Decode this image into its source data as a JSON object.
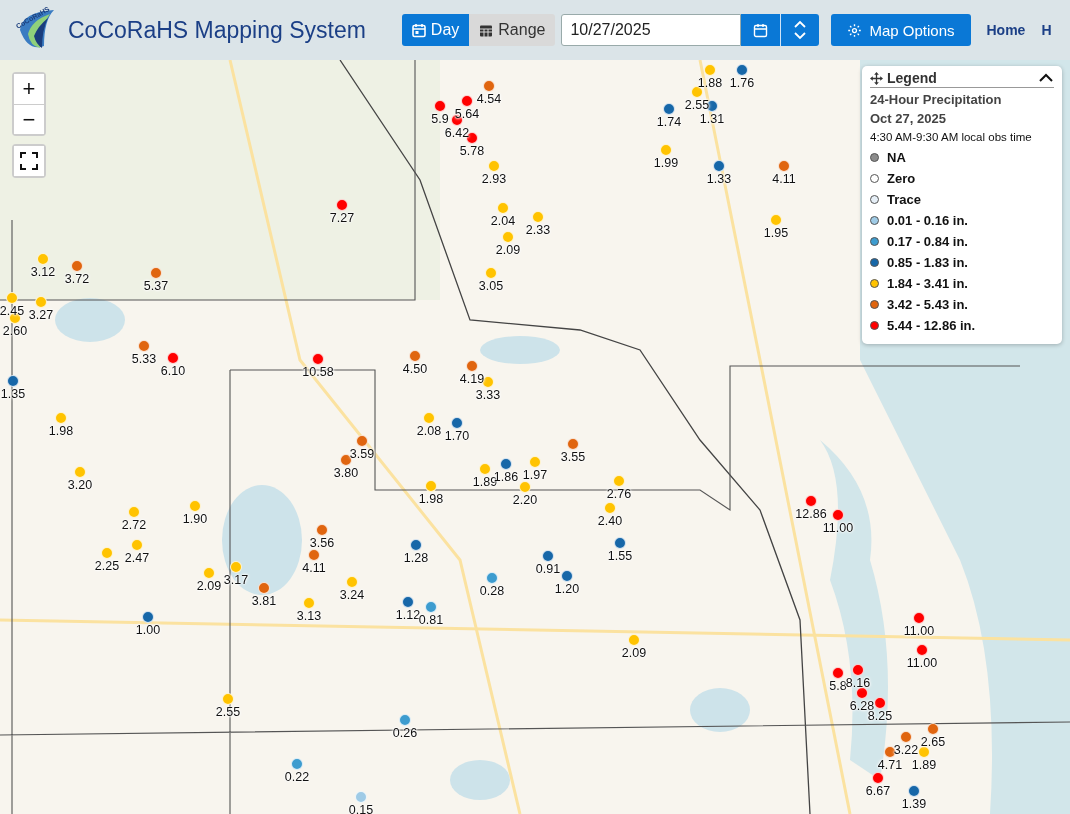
{
  "header": {
    "logo_text": "CoCoRaHS",
    "title": "CoCoRaHS Mapping System",
    "mode_tabs": [
      {
        "label": "Day",
        "selected": true
      },
      {
        "label": "Range",
        "selected": false
      }
    ],
    "date": {
      "value": "10/27/2025"
    },
    "map_options": "Map Options",
    "nav_links": [
      "Home",
      "H"
    ]
  },
  "map": {
    "controls": {
      "zoom_in": "+",
      "zoom_out": "−"
    },
    "stations": [
      {
        "value": "1.88",
        "color": "#ffc300"
      },
      {
        "value": "1.76",
        "color": "#1767a8"
      },
      {
        "value": "4.54",
        "color": "#e0650f"
      },
      {
        "value": "2.55",
        "color": "#ffc300"
      },
      {
        "value": "5.9",
        "color": "#ff0000"
      },
      {
        "value": "5.64",
        "color": "#ff0000"
      },
      {
        "value": "1.74",
        "color": "#1767a8"
      },
      {
        "value": "1.31",
        "color": "#1767a8"
      },
      {
        "value": "6.42",
        "color": "#ff0000"
      },
      {
        "value": "5.78",
        "color": "#ff0000"
      },
      {
        "value": "1.99",
        "color": "#ffc300"
      },
      {
        "value": "2.93",
        "color": "#ffc300"
      },
      {
        "value": "1.33",
        "color": "#1767a8"
      },
      {
        "value": "4.11",
        "color": "#e0650f"
      },
      {
        "value": "7.27",
        "color": "#ff0000"
      },
      {
        "value": "2.04",
        "color": "#ffc300"
      },
      {
        "value": "2.33",
        "color": "#ffc300"
      },
      {
        "value": "1.95",
        "color": "#ffc300"
      },
      {
        "value": "2.09",
        "color": "#ffc300"
      },
      {
        "value": "3.12",
        "color": "#ffc300"
      },
      {
        "value": "3.72",
        "color": "#e0650f"
      },
      {
        "value": "5.37",
        "color": "#e0650f"
      },
      {
        "value": "3.05",
        "color": "#ffc300"
      },
      {
        "value": "2.45",
        "color": "#ffc300"
      },
      {
        "value": "3.27",
        "color": "#ffc300"
      },
      {
        "value": "2.60",
        "color": "#ffc300"
      },
      {
        "value": "5.33",
        "color": "#e0650f"
      },
      {
        "value": "6.10",
        "color": "#ff0000"
      },
      {
        "value": "10.58",
        "color": "#ff0000"
      },
      {
        "value": "4.50",
        "color": "#e0650f"
      },
      {
        "value": "4.19",
        "color": "#e0650f"
      },
      {
        "value": "1.35",
        "color": "#1767a8"
      },
      {
        "value": "3.33",
        "color": "#ffc300"
      },
      {
        "value": "1.98",
        "color": "#ffc300"
      },
      {
        "value": "2.08",
        "color": "#ffc300"
      },
      {
        "value": "1.70",
        "color": "#1767a8"
      },
      {
        "value": "3.59",
        "color": "#e0650f"
      },
      {
        "value": "3.55",
        "color": "#e0650f"
      },
      {
        "value": "3.20",
        "color": "#ffc300"
      },
      {
        "value": "3.80",
        "color": "#e0650f"
      },
      {
        "value": "1.89",
        "color": "#ffc300"
      },
      {
        "value": "1.86",
        "color": "#1767a8"
      },
      {
        "value": "1.97",
        "color": "#ffc300"
      },
      {
        "value": "1.98",
        "color": "#ffc300"
      },
      {
        "value": "2.20",
        "color": "#ffc300"
      },
      {
        "value": "2.76",
        "color": "#ffc300"
      },
      {
        "value": "2.72",
        "color": "#ffc300"
      },
      {
        "value": "1.90",
        "color": "#ffc300"
      },
      {
        "value": "2.40",
        "color": "#ffc300"
      },
      {
        "value": "12.86",
        "color": "#ff0000"
      },
      {
        "value": "11.00",
        "color": "#ff0000"
      },
      {
        "value": "2.25",
        "color": "#ffc300"
      },
      {
        "value": "2.47",
        "color": "#ffc300"
      },
      {
        "value": "4.11",
        "color": "#e0650f"
      },
      {
        "value": "3.56",
        "color": "#e0650f"
      },
      {
        "value": "1.28",
        "color": "#1767a8"
      },
      {
        "value": "0.91",
        "color": "#1767a8"
      },
      {
        "value": "1.55",
        "color": "#1767a8"
      },
      {
        "value": "2.09",
        "color": "#ffc300"
      },
      {
        "value": "3.17",
        "color": "#ffc300"
      },
      {
        "value": "3.81",
        "color": "#e0650f"
      },
      {
        "value": "3.24",
        "color": "#ffc300"
      },
      {
        "value": "0.28",
        "color": "#3d9ccf"
      },
      {
        "value": "1.20",
        "color": "#1767a8"
      },
      {
        "value": "1.00",
        "color": "#1767a8"
      },
      {
        "value": "3.13",
        "color": "#ffc300"
      },
      {
        "value": "1.12",
        "color": "#1767a8"
      },
      {
        "value": "0.81",
        "color": "#3d9ccf"
      },
      {
        "value": "11.00",
        "color": "#ff0000"
      },
      {
        "value": "2.09",
        "color": "#ffc300"
      },
      {
        "value": "11.00",
        "color": "#ff0000"
      },
      {
        "value": "5.8",
        "color": "#ff0000"
      },
      {
        "value": "8.16",
        "color": "#ff0000"
      },
      {
        "value": "2.55",
        "color": "#ffc300"
      },
      {
        "value": "6.28",
        "color": "#ff0000"
      },
      {
        "value": "8.25",
        "color": "#ff0000"
      },
      {
        "value": "0.26",
        "color": "#3d9ccf"
      },
      {
        "value": "3.22",
        "color": "#e0650f"
      },
      {
        "value": "2.65",
        "color": "#e0650f"
      },
      {
        "value": "0.22",
        "color": "#3d9ccf"
      },
      {
        "value": "4.71",
        "color": "#e0650f"
      },
      {
        "value": "1.89",
        "color": "#ffc300"
      },
      {
        "value": "0.15",
        "color": "#9fcbe6"
      },
      {
        "value": "6.67",
        "color": "#ff0000"
      },
      {
        "value": "1.39",
        "color": "#1767a8"
      }
    ]
  },
  "legend": {
    "title": "Legend",
    "expanded": true,
    "heading": "24-Hour Precipitation",
    "date": "Oct 27, 2025",
    "obs_time": "4:30 AM-9:30 AM local obs time",
    "items": [
      {
        "label": "NA",
        "color": "#8c8c8c"
      },
      {
        "label": "Zero",
        "color": "#ffffff"
      },
      {
        "label": "Trace",
        "color": "#e6eff7"
      },
      {
        "label": "0.01 - 0.16 in.",
        "color": "#9fcbe6"
      },
      {
        "label": "0.17 - 0.84 in.",
        "color": "#3d9ccf"
      },
      {
        "label": "0.85 - 1.83 in.",
        "color": "#1767a8"
      },
      {
        "label": "1.84 - 3.41 in.",
        "color": "#ffc300"
      },
      {
        "label": "3.42 - 5.43 in.",
        "color": "#e0650f"
      },
      {
        "label": "5.44 - 12.86 in.",
        "color": "#ff0000"
      }
    ]
  }
}
